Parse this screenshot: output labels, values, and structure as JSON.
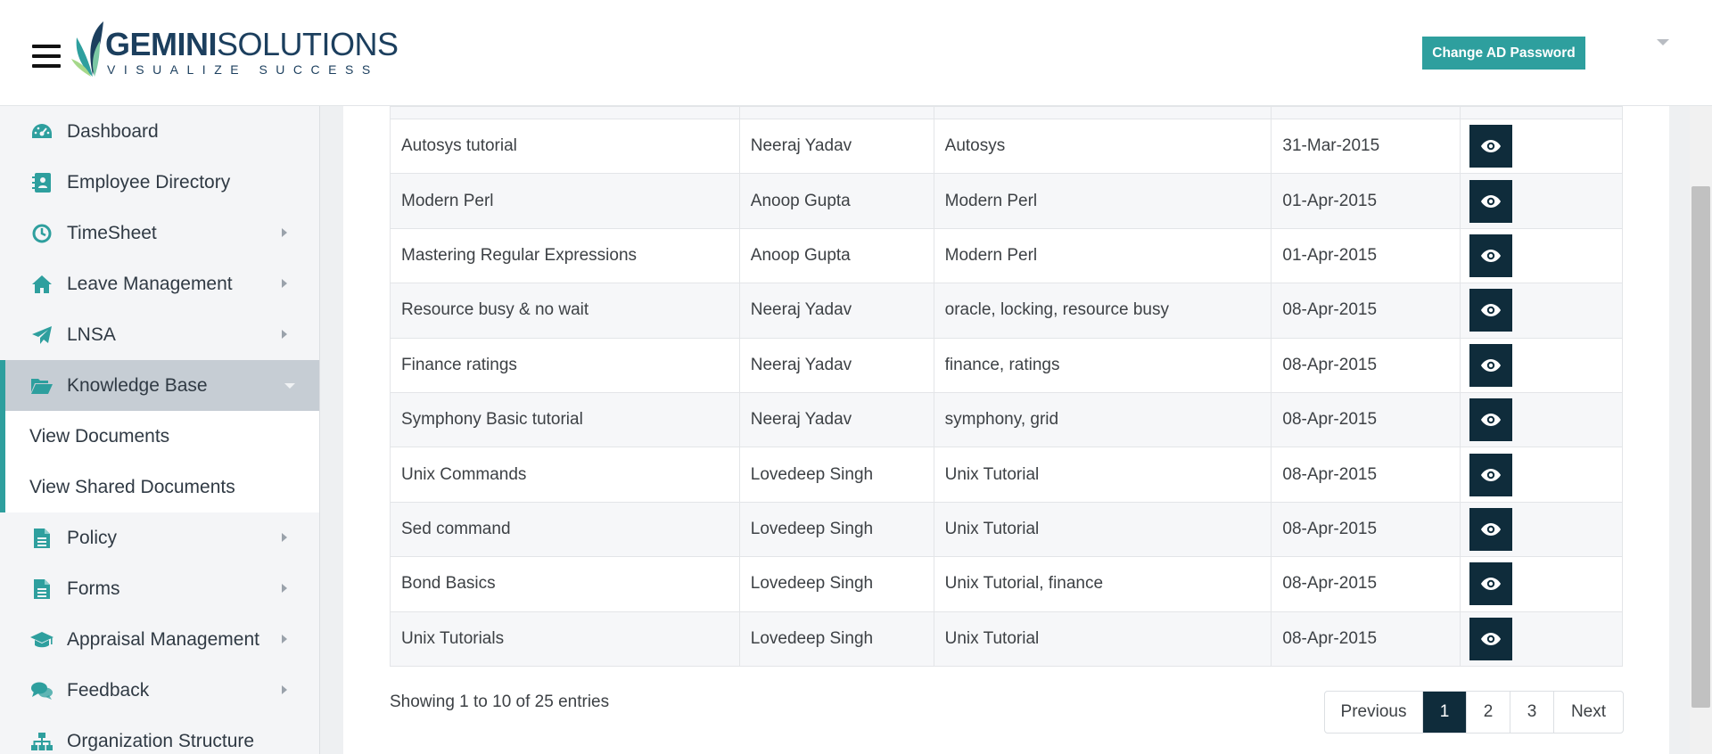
{
  "header": {
    "logo_brand_bold": "GEMINI",
    "logo_brand_rest": "SOLUTIONS",
    "logo_tagline": "VISUALIZE SUCCESS",
    "change_password_label": "Change AD Password"
  },
  "sidebar": {
    "items": [
      {
        "label": "Dashboard",
        "icon": "dashboard-icon"
      },
      {
        "label": "Employee Directory",
        "icon": "address-book-icon"
      },
      {
        "label": "TimeSheet",
        "icon": "clock-icon"
      },
      {
        "label": "Leave Management",
        "icon": "home-icon"
      },
      {
        "label": "LNSA",
        "icon": "paper-plane-icon"
      },
      {
        "label": "Knowledge Base",
        "icon": "folder-open-icon"
      },
      {
        "label": "Policy",
        "icon": "document-icon"
      },
      {
        "label": "Forms",
        "icon": "document-icon"
      },
      {
        "label": "Appraisal Management",
        "icon": "graduation-cap-icon"
      },
      {
        "label": "Feedback",
        "icon": "comments-icon"
      },
      {
        "label": "Organization Structure",
        "icon": "sitemap-icon"
      }
    ],
    "submenu": [
      {
        "label": "View Documents"
      },
      {
        "label": "View Shared Documents"
      }
    ]
  },
  "table": {
    "rows": [
      {
        "title": "Autosys tutorial",
        "author": "Neeraj Yadav",
        "tags": "Autosys",
        "date": "31-Mar-2015"
      },
      {
        "title": "Modern Perl",
        "author": "Anoop Gupta",
        "tags": "Modern Perl",
        "date": "01-Apr-2015"
      },
      {
        "title": "Mastering Regular Expressions",
        "author": "Anoop Gupta",
        "tags": "Modern Perl",
        "date": "01-Apr-2015"
      },
      {
        "title": "Resource busy & no wait",
        "author": "Neeraj Yadav",
        "tags": "oracle, locking, resource busy",
        "date": "08-Apr-2015"
      },
      {
        "title": "Finance ratings",
        "author": "Neeraj Yadav",
        "tags": "finance, ratings",
        "date": "08-Apr-2015"
      },
      {
        "title": "Symphony Basic tutorial",
        "author": "Neeraj Yadav",
        "tags": "symphony, grid",
        "date": "08-Apr-2015"
      },
      {
        "title": "Unix Commands",
        "author": "Lovedeep Singh",
        "tags": "Unix Tutorial",
        "date": "08-Apr-2015"
      },
      {
        "title": "Sed command",
        "author": "Lovedeep Singh",
        "tags": "Unix Tutorial",
        "date": "08-Apr-2015"
      },
      {
        "title": "Bond Basics",
        "author": "Lovedeep Singh",
        "tags": "Unix Tutorial, finance",
        "date": "08-Apr-2015"
      },
      {
        "title": "Unix Tutorials",
        "author": "Lovedeep Singh",
        "tags": "Unix Tutorial",
        "date": "08-Apr-2015"
      }
    ]
  },
  "footer": {
    "info": "Showing 1 to 10 of 25 entries",
    "previous": "Previous",
    "pages": [
      "1",
      "2",
      "3"
    ],
    "next": "Next"
  },
  "colors": {
    "accent": "#2e9f9e",
    "dark_button": "#0f2c3b",
    "brand_navy": "#1c3f5e"
  }
}
